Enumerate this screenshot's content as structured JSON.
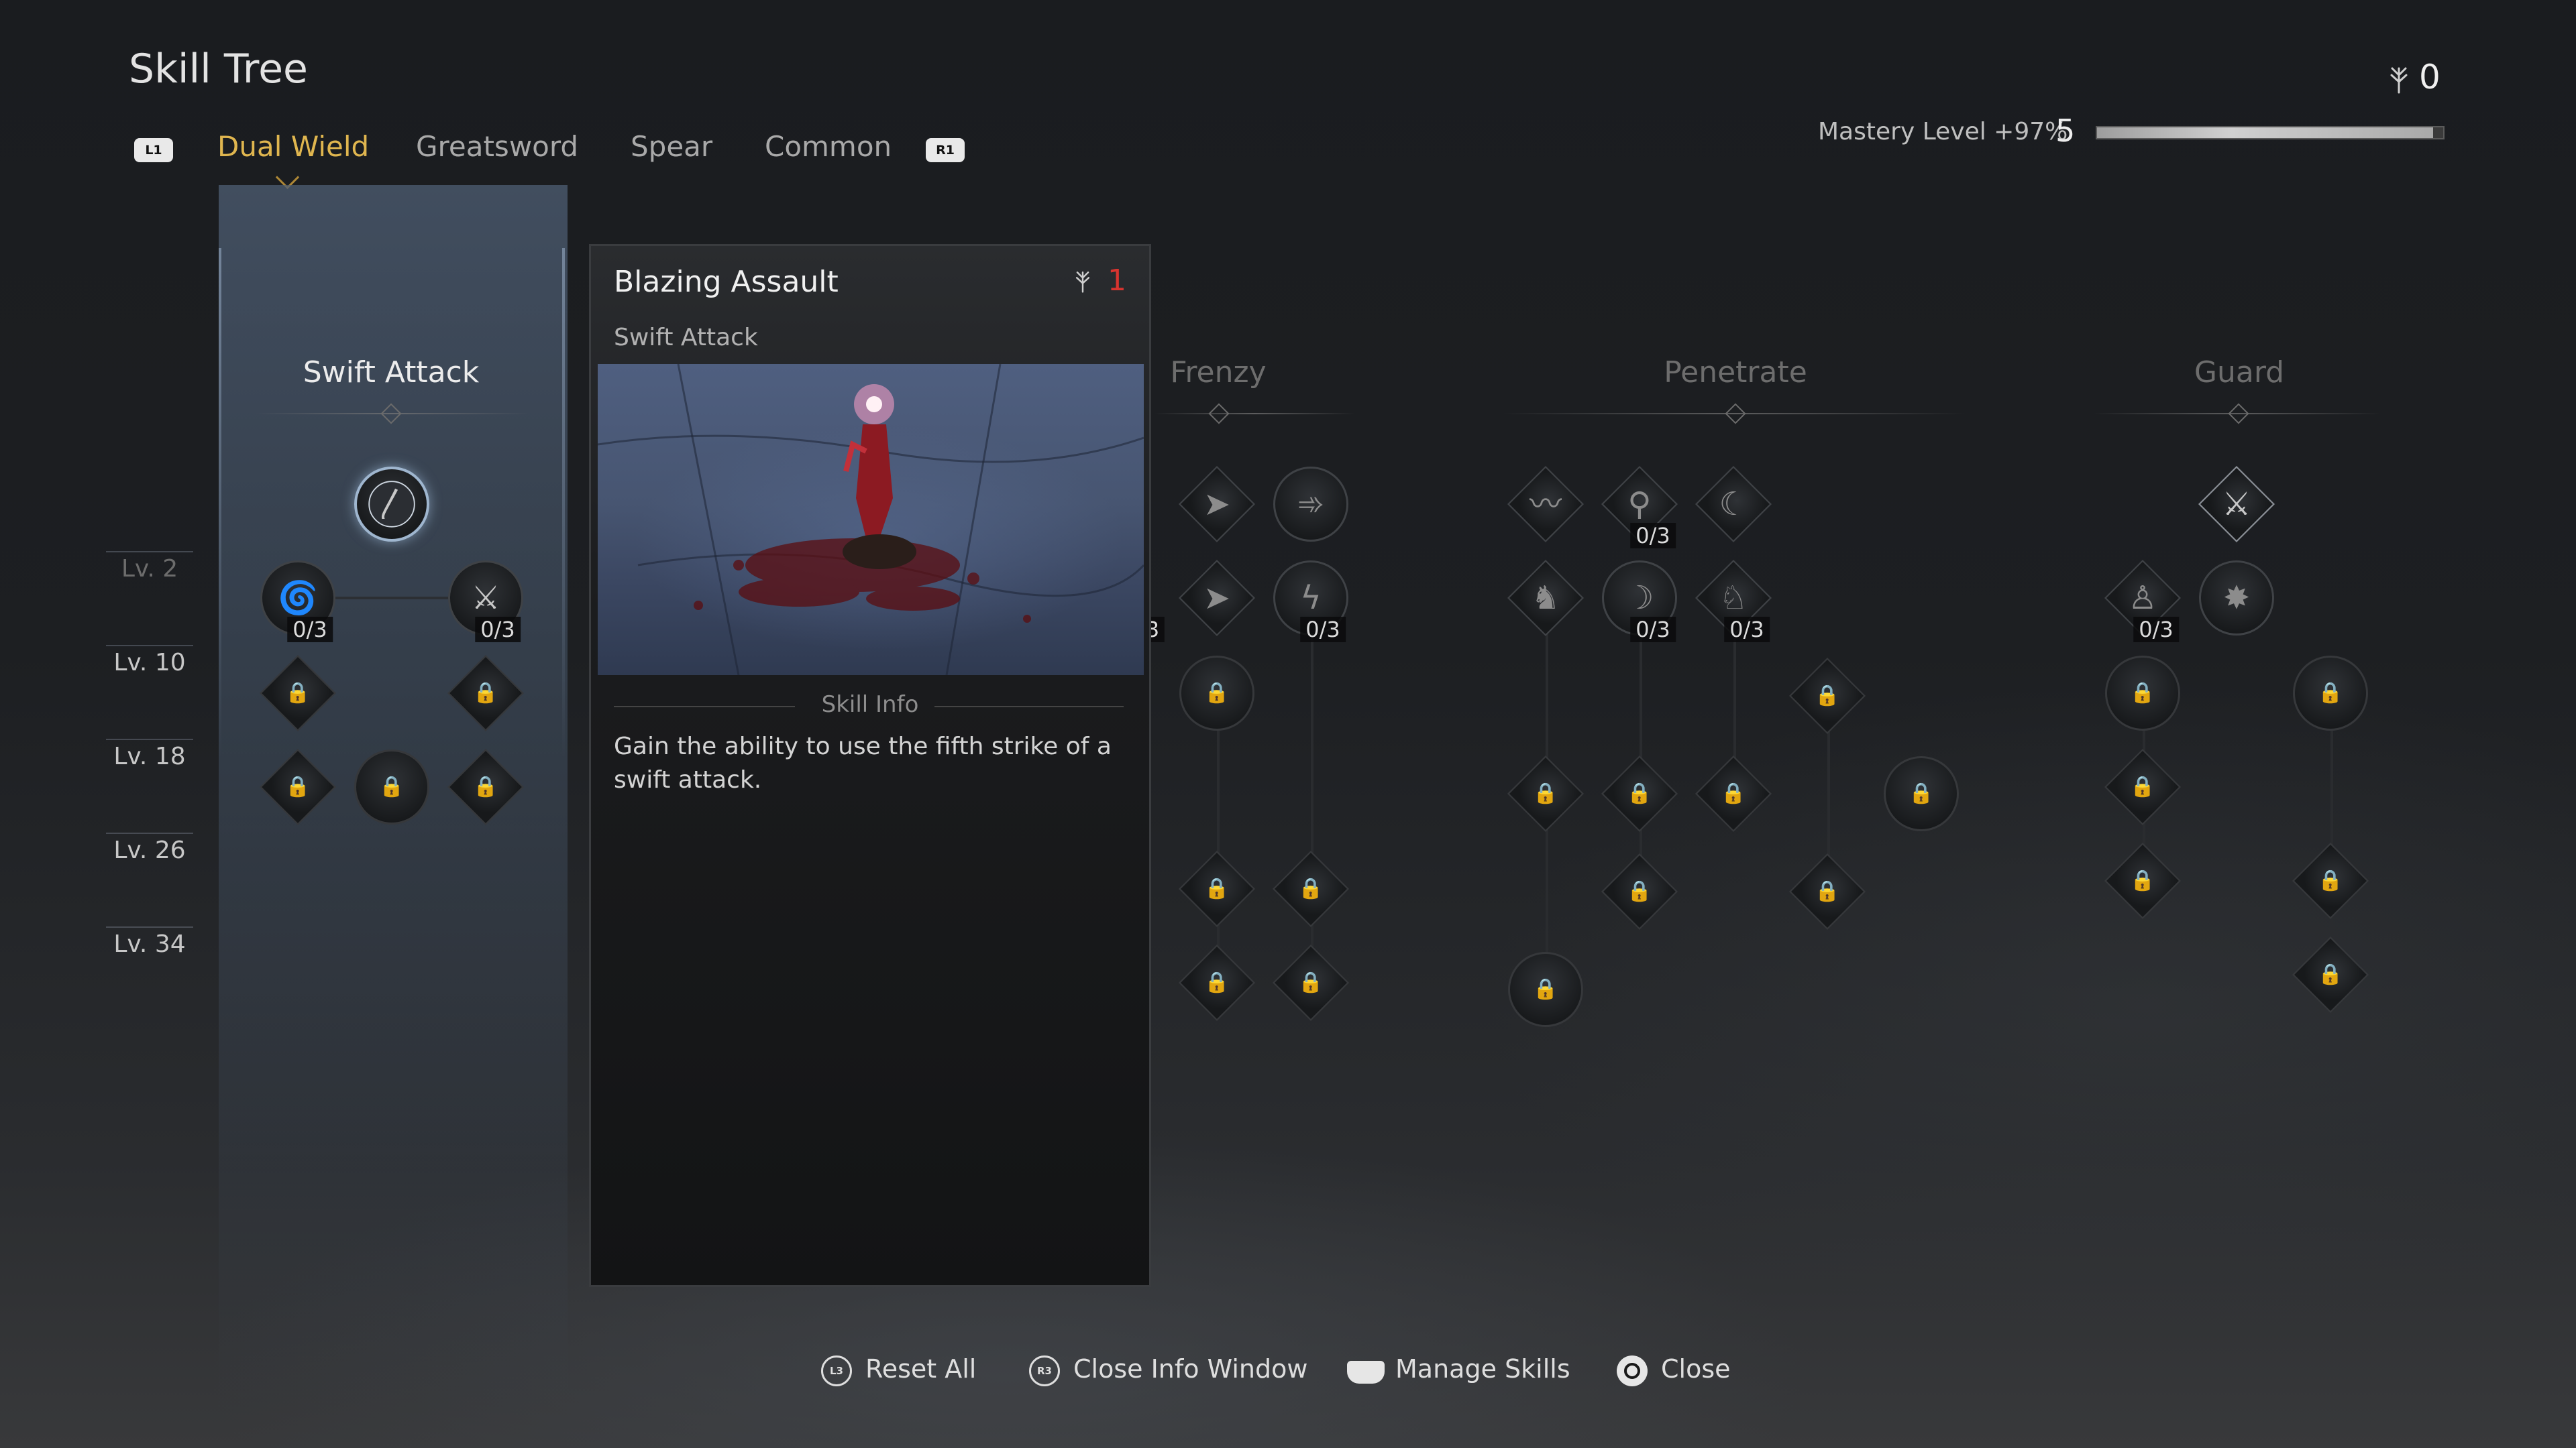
{
  "header": {
    "title": "Skill Tree",
    "points": "0",
    "mastery_label": "Mastery Level +97%",
    "mastery_level": "5",
    "mastery_progress": 0.97,
    "left_bumper": "L1",
    "right_bumper": "R1"
  },
  "tabs": [
    {
      "label": "Dual Wield",
      "active": true
    },
    {
      "label": "Greatsword",
      "active": false
    },
    {
      "label": "Spear",
      "active": false
    },
    {
      "label": "Common",
      "active": false
    }
  ],
  "levels": [
    "Lv. 2",
    "Lv. 10",
    "Lv. 18",
    "Lv. 26",
    "Lv. 34"
  ],
  "categories": {
    "swift_attack": "Swift Attack",
    "frenzy": "Frenzy",
    "penetrate": "Penetrate",
    "guard": "Guard"
  },
  "counters": {
    "swift_left": "0/3",
    "swift_right": "0/3",
    "frenzy_partial": "3",
    "frenzy_r2": "0/3",
    "penetrate_a": "0/3",
    "penetrate_b": "0/3",
    "penetrate_c": "0/3",
    "guard_a": "0/3"
  },
  "info": {
    "title": "Blazing Assault",
    "cost": "1",
    "subtitle": "Swift Attack",
    "section": "Skill Info",
    "description": "Gain the ability to use the fifth strike of a swift attack."
  },
  "footer": {
    "reset_all": "Reset All",
    "reset_btn": "L3",
    "close_info": "Close Info Window",
    "close_info_btn": "R3",
    "manage": "Manage Skills",
    "close": "Close"
  },
  "colors": {
    "accent_tab": "#e0b64f",
    "cost": "#d8342f"
  }
}
